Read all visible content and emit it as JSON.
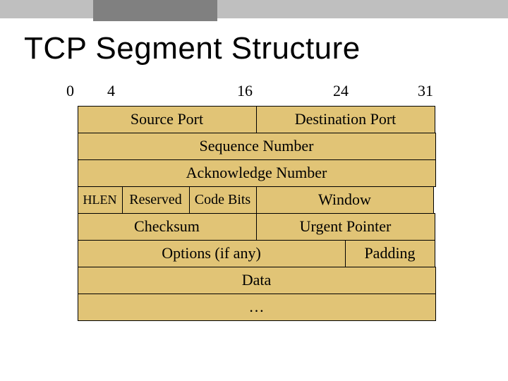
{
  "title": "TCP  Segment Structure",
  "bitLabels": {
    "b0": "0",
    "b4": "4",
    "b16": "16",
    "b24": "24",
    "b31": "31"
  },
  "fields": {
    "sourcePort": "Source Port",
    "destPort": "Destination Port",
    "seqNum": "Sequence Number",
    "ackNum": "Acknowledge Number",
    "hlen": "HLEN",
    "reserved": "Reserved",
    "codeBits": "Code Bits",
    "window": "Window",
    "checksum": "Checksum",
    "urgent": "Urgent Pointer",
    "options": "Options (if any)",
    "padding": "Padding",
    "data": "Data",
    "cont": "…"
  }
}
